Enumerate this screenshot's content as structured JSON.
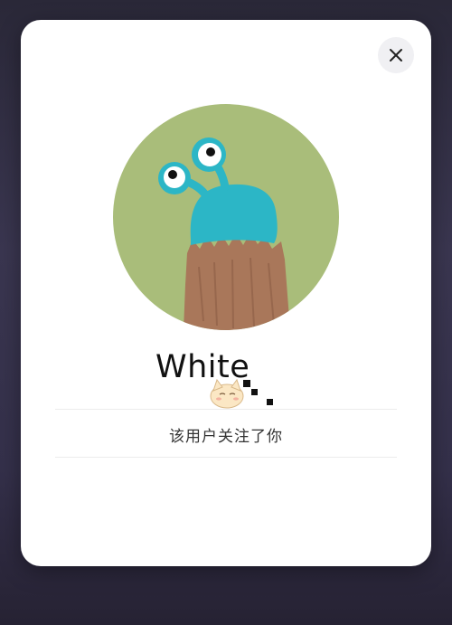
{
  "profile_card": {
    "username": "White",
    "follow_status": "该用户关注了你"
  },
  "icons": {
    "close": "close-icon",
    "avatar": "cartoon-creature-avatar",
    "decoration": "cat-sticker-icon"
  },
  "colors": {
    "card_background": "#ffffff",
    "avatar_background": "#a9bd7a",
    "close_button_bg": "#f0f0f3",
    "text_primary": "#111111"
  }
}
